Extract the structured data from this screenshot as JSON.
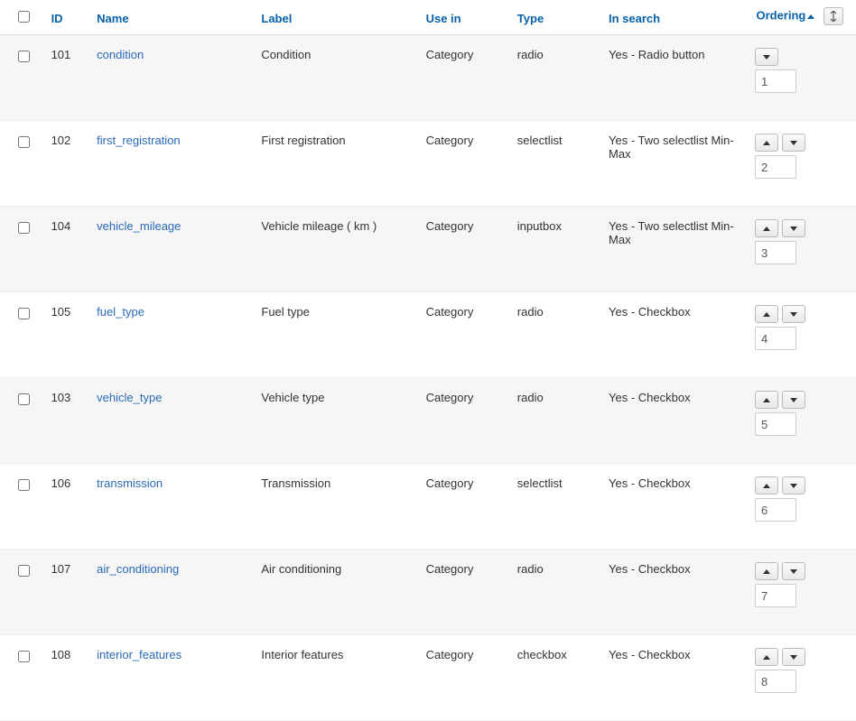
{
  "columns": {
    "id": "ID",
    "name": "Name",
    "label": "Label",
    "use_in": "Use in",
    "type": "Type",
    "in_search": "In search",
    "ordering": "Ordering"
  },
  "rows": [
    {
      "id": "101",
      "name": "condition",
      "label": "Condition",
      "use_in": "Category",
      "type": "radio",
      "in_search": "Yes - Radio button",
      "order": "1",
      "up": false,
      "down": true
    },
    {
      "id": "102",
      "name": "first_registration",
      "label": "First registration",
      "use_in": "Category",
      "type": "selectlist",
      "in_search": "Yes - Two selectlist Min-Max",
      "order": "2",
      "up": true,
      "down": true
    },
    {
      "id": "104",
      "name": "vehicle_mileage",
      "label": "Vehicle mileage ( km )",
      "use_in": "Category",
      "type": "inputbox",
      "in_search": "Yes - Two selectlist Min-Max",
      "order": "3",
      "up": true,
      "down": true
    },
    {
      "id": "105",
      "name": "fuel_type",
      "label": "Fuel type",
      "use_in": "Category",
      "type": "radio",
      "in_search": "Yes - Checkbox",
      "order": "4",
      "up": true,
      "down": true
    },
    {
      "id": "103",
      "name": "vehicle_type",
      "label": "Vehicle type",
      "use_in": "Category",
      "type": "radio",
      "in_search": "Yes - Checkbox",
      "order": "5",
      "up": true,
      "down": true
    },
    {
      "id": "106",
      "name": "transmission",
      "label": "Transmission",
      "use_in": "Category",
      "type": "selectlist",
      "in_search": "Yes - Checkbox",
      "order": "6",
      "up": true,
      "down": true
    },
    {
      "id": "107",
      "name": "air_conditioning",
      "label": "Air conditioning",
      "use_in": "Category",
      "type": "radio",
      "in_search": "Yes - Checkbox",
      "order": "7",
      "up": true,
      "down": true
    },
    {
      "id": "108",
      "name": "interior_features",
      "label": "Interior features",
      "use_in": "Category",
      "type": "checkbox",
      "in_search": "Yes - Checkbox",
      "order": "8",
      "up": true,
      "down": true
    }
  ]
}
